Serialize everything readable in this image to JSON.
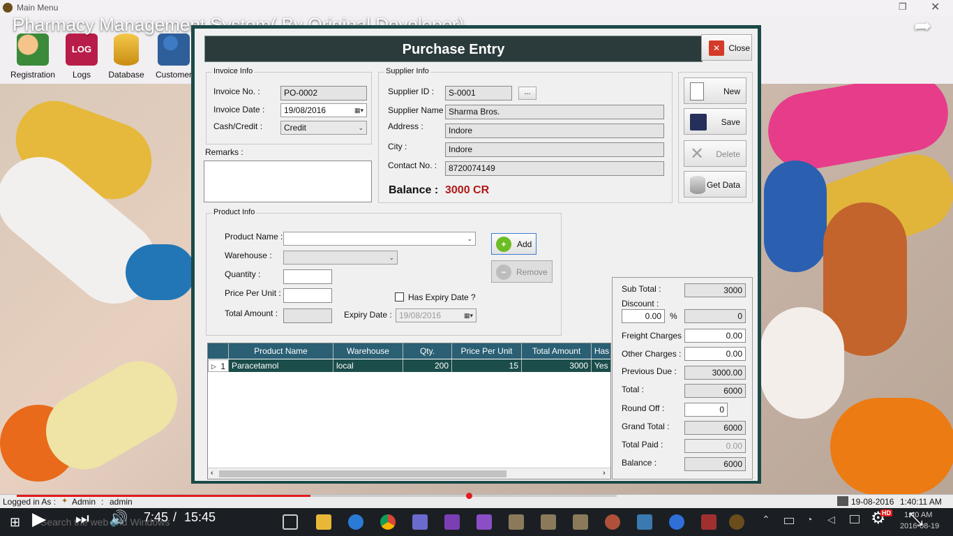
{
  "video": {
    "title": "Pharmacy Management System( By Original Developer)",
    "time_current": "7:45",
    "time_total": "15:45",
    "progress_fraction": 0.49,
    "hd_badge": "HD"
  },
  "main_window": {
    "title": "Main Menu",
    "toolbar": [
      {
        "label": "Registration",
        "icon": "users-icon"
      },
      {
        "label": "Logs",
        "icon": "log-icon",
        "icon_text": "LOG"
      },
      {
        "label": "Database",
        "icon": "database-icon"
      },
      {
        "label": "Customer",
        "icon": "customer-icon"
      }
    ]
  },
  "form": {
    "title": "Purchase Entry",
    "close_label": "Close",
    "invoice": {
      "group_label": "Invoice Info",
      "invoice_no_label": "Invoice No. :",
      "invoice_no": "PO-0002",
      "invoice_date_label": "Invoice Date :",
      "invoice_date": "19/08/2016",
      "cash_credit_label": "Cash/Credit :",
      "cash_credit": "Credit",
      "remarks_label": "Remarks :"
    },
    "supplier": {
      "group_label": "Supplier Info",
      "supplier_id_label": "Supplier ID :",
      "supplier_id": "S-0001",
      "browse_label": "...",
      "supplier_name_label": "Supplier Name :",
      "supplier_name": "Sharma Bros.",
      "address_label": "Address :",
      "address": "Indore",
      "city_label": "City :",
      "city": "Indore",
      "contact_label": "Contact No. :",
      "contact": "8720074149",
      "balance_label": "Balance :",
      "balance": "3000 CR"
    },
    "actions": {
      "new": "New",
      "save": "Save",
      "delete": "Delete",
      "get_data": "Get Data"
    },
    "product": {
      "group_label": "Product Info",
      "name_label": "Product Name :",
      "warehouse_label": "Warehouse :",
      "quantity_label": "Quantity :",
      "price_label": "Price Per Unit :",
      "total_label": "Total Amount :",
      "expiry_check_label": "Has Expiry Date ?",
      "expiry_label": "Expiry Date :",
      "expiry_date": "19/08/2016",
      "add_label": "Add",
      "remove_label": "Remove"
    },
    "grid": {
      "columns": [
        "",
        "Product Name",
        "Warehouse",
        "Qty.",
        "Price Per Unit",
        "Total Amount",
        "Has"
      ],
      "rows": [
        {
          "index": "1",
          "product": "Paracetamol",
          "warehouse": "local",
          "qty": "200",
          "price": "15",
          "total": "3000",
          "has": "Yes"
        }
      ]
    },
    "totals": {
      "sub_total_label": "Sub Total :",
      "sub_total": "3000",
      "discount_label": "Discount :",
      "discount_pct": "0.00",
      "pct_sign": "%",
      "discount_amt": "0",
      "freight_label": "Freight Charges :",
      "freight": "0.00",
      "other_label": "Other Charges :",
      "other": "0.00",
      "prev_due_label": "Previous Due :",
      "prev_due": "3000.00",
      "total_label": "Total :",
      "total": "6000",
      "round_off_label": "Round Off :",
      "round_off": "0",
      "grand_total_label": "Grand Total :",
      "grand_total": "6000",
      "total_paid_label": "Total Paid :",
      "total_paid": "0.00",
      "balance_label": "Balance :",
      "balance": "6000"
    }
  },
  "statusbar": {
    "logged_in_label": "Logged in As :",
    "role": "Admin",
    "sep": ":",
    "user": "admin",
    "date": "19-08-2016",
    "time": "1:40:11 AM"
  },
  "taskbar": {
    "search_placeholder": "Search the web and Windows",
    "clock_time": "1:40 AM",
    "clock_date": "2016-08-19"
  },
  "colors": {
    "form_frame": "#1c4a48",
    "title_bar": "#2b3a3a",
    "grid_header": "#2a5f74",
    "balance_red": "#b01818",
    "progress_red": "#e41b1b"
  }
}
